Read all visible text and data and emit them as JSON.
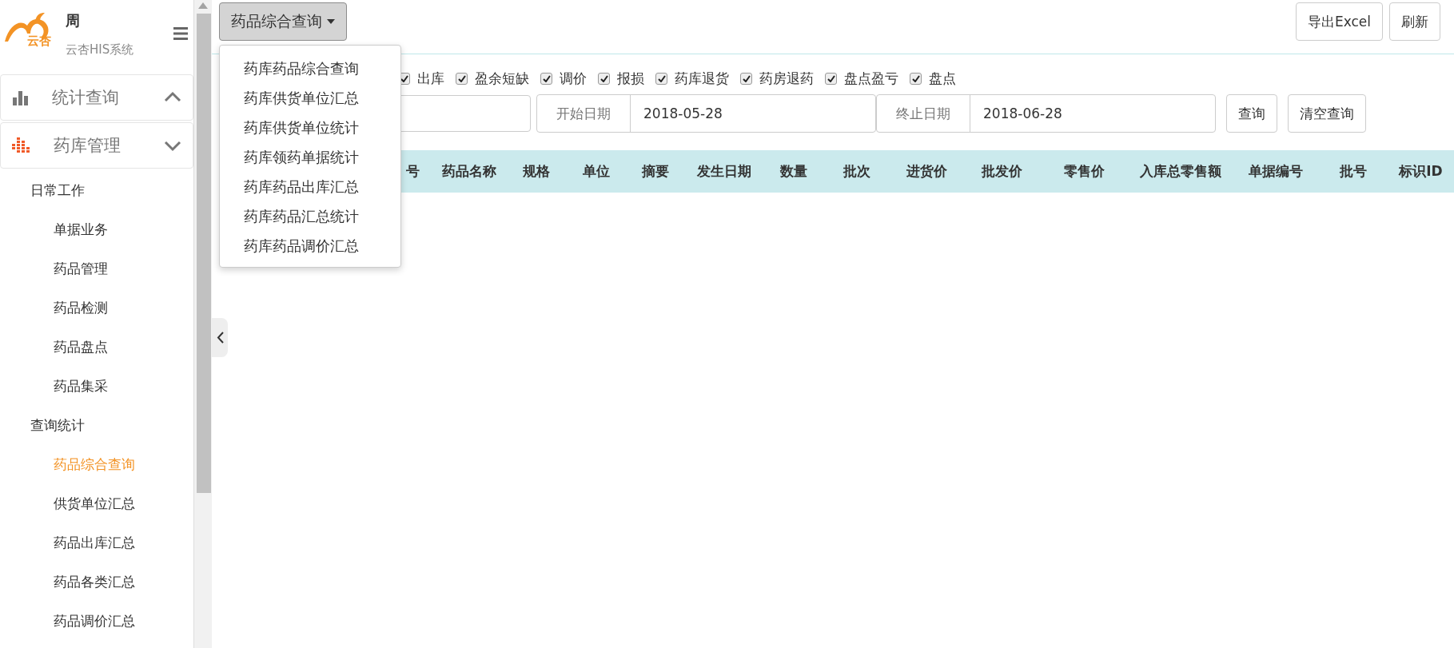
{
  "sidebar": {
    "logo_text": "云杏",
    "user_name": "周",
    "system_name": "云杏HIS系统",
    "sections": [
      {
        "label": "统计查询",
        "active": false,
        "expanded": true
      },
      {
        "label": "药库管理",
        "active": true,
        "expanded": false
      }
    ],
    "groups": [
      {
        "label": "日常工作",
        "children": [
          {
            "label": "单据业务",
            "selected": false
          },
          {
            "label": "药品管理",
            "selected": false
          },
          {
            "label": "药品检测",
            "selected": false
          },
          {
            "label": "药品盘点",
            "selected": false
          },
          {
            "label": "药品集采",
            "selected": false
          }
        ]
      },
      {
        "label": "查询统计",
        "children": [
          {
            "label": "药品综合查询",
            "selected": true
          },
          {
            "label": "供货单位汇总",
            "selected": false
          },
          {
            "label": "药品出库汇总",
            "selected": false
          },
          {
            "label": "药品各类汇总",
            "selected": false
          },
          {
            "label": "药品调价汇总",
            "selected": false
          }
        ]
      }
    ]
  },
  "toolbar": {
    "dropdown": {
      "label": "药品综合查询",
      "expanded": true,
      "options": [
        "药库药品综合查询",
        "药库供货单位汇总",
        "药库供货单位统计",
        "药库领药单据统计",
        "药库药品出库汇总",
        "药库药品汇总统计",
        "药库药品调价汇总"
      ]
    },
    "buttons": [
      "导出Excel",
      "刷新"
    ]
  },
  "filters": [
    {
      "label": "出库",
      "checked": true
    },
    {
      "label": "盈余短缺",
      "checked": true
    },
    {
      "label": "调价",
      "checked": true
    },
    {
      "label": "报损",
      "checked": true
    },
    {
      "label": "药库退货",
      "checked": true
    },
    {
      "label": "药房退药",
      "checked": true
    },
    {
      "label": "盘点盈亏",
      "checked": true
    },
    {
      "label": "盘点",
      "checked": true
    }
  ],
  "date_fields": [
    {
      "label": "开始日期",
      "value": "2018-05-28"
    },
    {
      "label": "终止日期",
      "value": "2018-06-28"
    }
  ],
  "query_buttons": [
    "查询",
    "清空查询"
  ],
  "table": {
    "columns": [
      "号",
      "药品名称",
      "规格",
      "单位",
      "摘要",
      "发生日期",
      "数量",
      "批次",
      "进货价",
      "批发价",
      "零售价",
      "入库总零售额",
      "单据编号",
      "批号",
      "标识ID"
    ]
  }
}
